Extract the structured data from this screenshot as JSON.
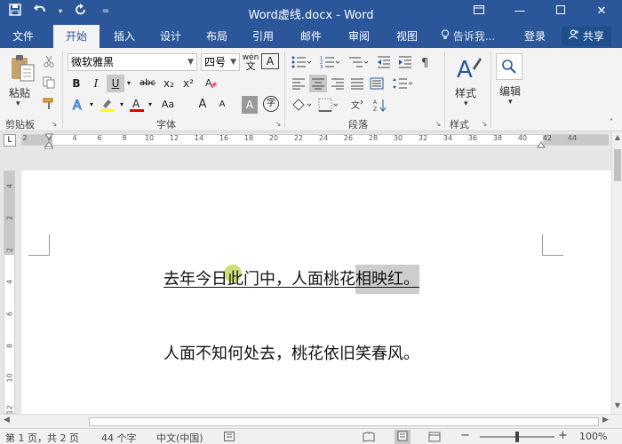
{
  "titlebar": {
    "title": "Word虚线.docx - Word",
    "icons": [
      "save-icon",
      "undo-icon",
      "redo-icon",
      "customize-icon"
    ],
    "window_controls": [
      "ribbon-display-icon",
      "minimize-icon",
      "maximize-icon",
      "close-icon"
    ]
  },
  "tabs": {
    "file": "文件",
    "home": "开始",
    "insert": "插入",
    "design": "设计",
    "layout": "布局",
    "references": "引用",
    "mailings": "邮件",
    "review": "审阅",
    "view": "视图",
    "tell_me": "告诉我...",
    "login": "登录",
    "share": "共享"
  },
  "ribbon": {
    "clipboard": {
      "paste": "粘贴",
      "group_label": "剪贴板"
    },
    "font": {
      "font_name": "微软雅黑",
      "font_size": "四号",
      "bold": "B",
      "italic": "I",
      "underline": "U",
      "strike": "abc",
      "subscript": "x₂",
      "superscript": "x²",
      "grow": "A",
      "shrink": "A",
      "aa": "Aa",
      "phonetic": "wén",
      "char_border": "A",
      "char_shading": "A",
      "enclose": "字",
      "group_label": "字体"
    },
    "paragraph": {
      "group_label": "段落"
    },
    "styles": {
      "label": "样式",
      "group_label": "样式"
    },
    "editing": {
      "label": "编辑"
    }
  },
  "ruler": {
    "numbers": [
      "2",
      "2",
      "4",
      "6",
      "8",
      "10",
      "12",
      "14",
      "16",
      "18",
      "20",
      "22",
      "24",
      "26",
      "28",
      "30",
      "32",
      "34",
      "36",
      "38",
      "40",
      "42",
      "44"
    ],
    "tab_selector": "L"
  },
  "vruler": {
    "numbers": [
      "4",
      "2",
      "2",
      "4",
      "6",
      "8",
      "10",
      "12"
    ]
  },
  "document": {
    "line1_underlined": "去年今日此门中，人面桃花",
    "line1_selected": "相映红。",
    "line2": "人面不知何处去，桃花依旧笑春风。"
  },
  "statusbar": {
    "page": "第 1 页，共 2 页",
    "words": "44 个字",
    "language": "中文(中国)",
    "zoom": "100%",
    "zoom_level": 100
  },
  "colors": {
    "titlebar": "#2b579a",
    "ribbon": "#f3f3f3",
    "highlight_yellow": "#ffff00",
    "font_red": "#e00000"
  }
}
